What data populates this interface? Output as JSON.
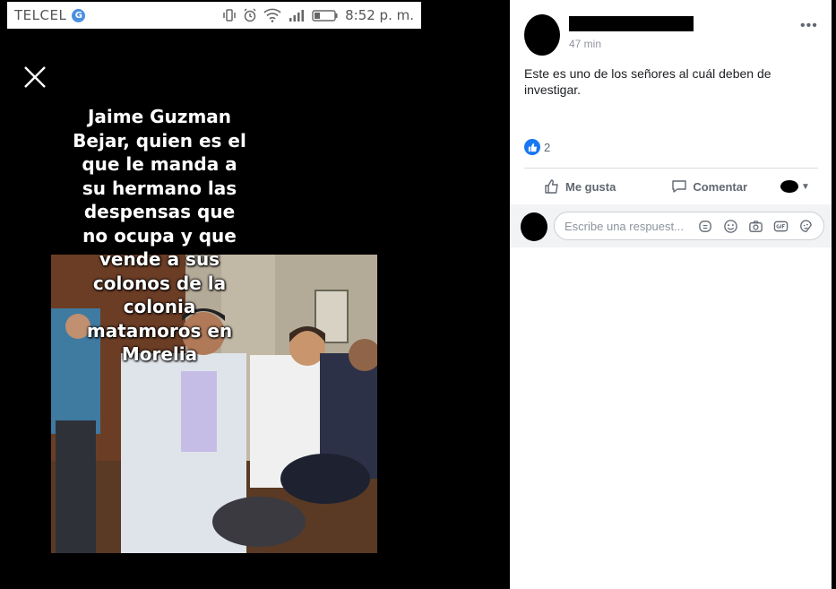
{
  "statusbar": {
    "carrier": "TELCEL",
    "time": "8:52 p. m."
  },
  "overlay": {
    "text": "Jaime Guzman\nBejar, quien es el\nque le manda a\nsu hermano las\ndespensas que\nno ocupa y que\nvende a sus\ncolonos de la\ncolonia\nmatamoros en\nMorelia"
  },
  "post": {
    "time": "47 min",
    "text": "Este es uno de los señores al cuál deben de investigar.",
    "like_count": "2"
  },
  "actions": {
    "like_label": "Me gusta",
    "comment_label": "Comentar"
  },
  "comment_box": {
    "placeholder": "Escribe una respuest..."
  },
  "colors": {
    "accent": "#1877f2",
    "text_secondary": "#606770",
    "comment_bg": "#f2f3f5"
  }
}
